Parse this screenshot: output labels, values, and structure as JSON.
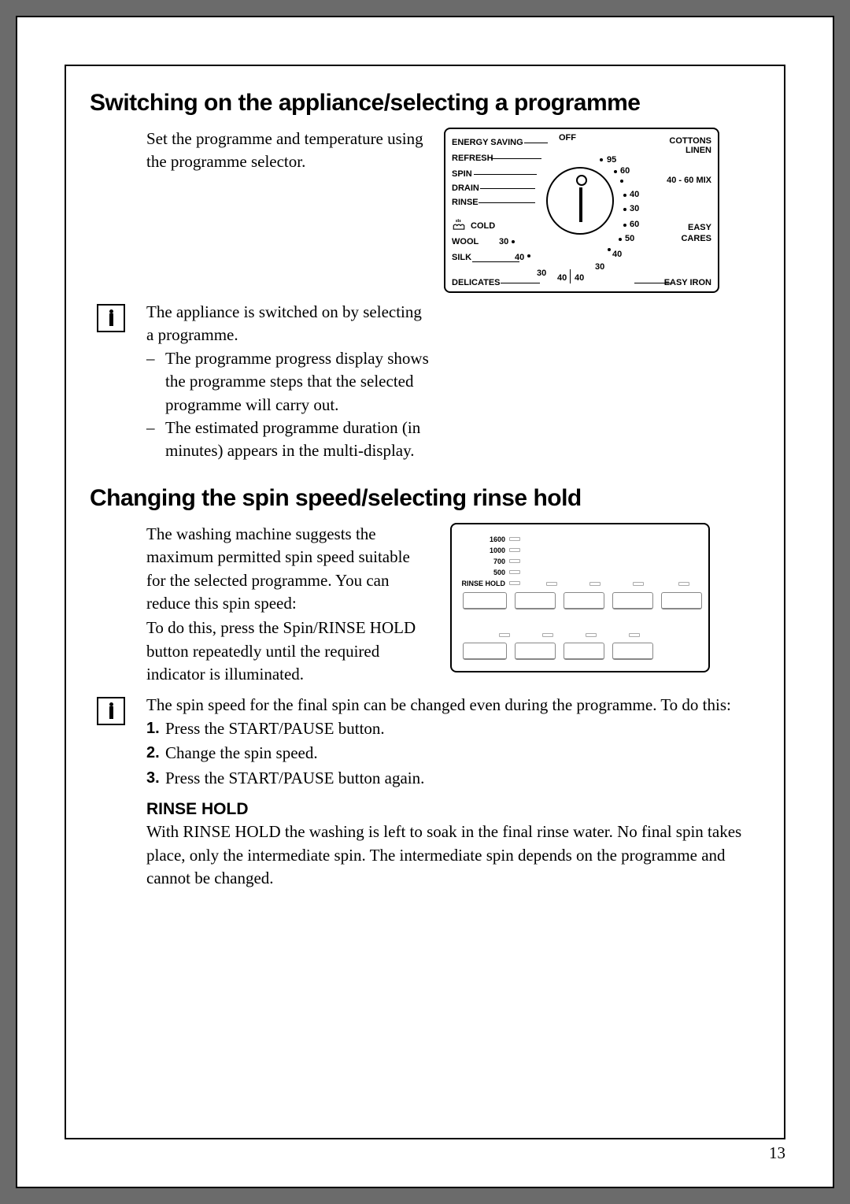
{
  "section1": {
    "heading": "Switching on the appliance/selecting a programme",
    "intro": "Set the programme and tempera­ture using the programme selector.",
    "info_para": "The appliance is switched on by se­lecting a programme.",
    "bullets": [
      "The programme progress display shows the programme steps that the selected programme will car­ry out.",
      "The estimated programme dura­tion (in minutes) appears in the multi-display."
    ]
  },
  "dial": {
    "off": "OFF",
    "left_labels": [
      "ENERGY SAVING",
      "REFRESH",
      "SPIN",
      "DRAIN",
      "RINSE",
      "COLD",
      "WOOL",
      "SILK"
    ],
    "bottom_left": "DELICATES",
    "bottom_right": "EASY IRON",
    "right_labels": [
      "COTTONS",
      "LINEN",
      "40 - 60 MIX",
      "EASY",
      "CARES"
    ],
    "temps_right": [
      "95",
      "60",
      "40",
      "30",
      "60",
      "50",
      "40",
      "30"
    ],
    "temps_bottom": [
      "30",
      "40",
      "30",
      "40",
      "40"
    ]
  },
  "section2": {
    "heading": "Changing the spin speed/selecting rinse hold",
    "para1": "The washing machine suggests the maximum permitted spin speed suitable for the selected pro­gramme. You can reduce this spin speed:",
    "para2": "To do this, press the Spin/RINSE HOLD button repeatedly until the required indicator is illuminated.",
    "info_para": "The spin speed for the final spin can be changed even during the pro­gramme. To do this:",
    "steps": [
      "Press the START/PAUSE button.",
      "Change the spin speed.",
      "Press the START/PAUSE button again."
    ],
    "sub_heading": "RINSE HOLD",
    "sub_para": "With RINSE HOLD the washing is left to soak in the final rinse water. No final spin takes place, only the intermediate spin. The intermediate spin depends on the programme and cannot be changed."
  },
  "panel": {
    "spins": [
      "1600",
      "1000",
      "700",
      "500",
      "RINSE HOLD"
    ]
  },
  "page_number": "13"
}
